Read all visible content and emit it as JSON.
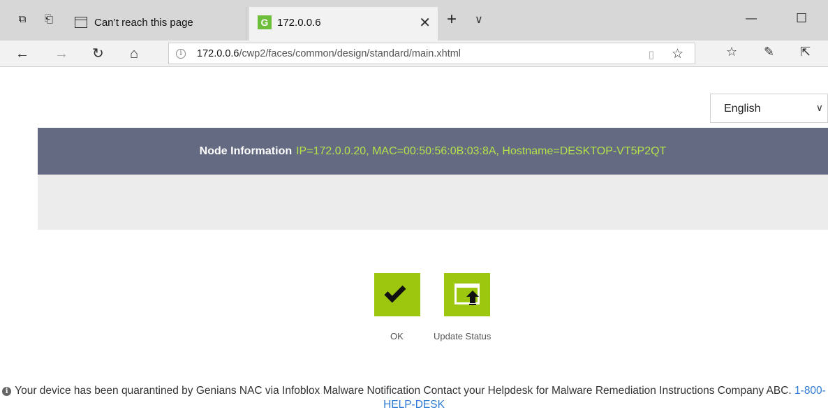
{
  "browser": {
    "tabs": [
      {
        "label": "Can’t reach this page",
        "icon": "page-icon",
        "active": false
      },
      {
        "label": "172.0.0.6",
        "icon": "genians-logo-icon",
        "favicon_letter": "G",
        "active": true
      }
    ],
    "address": {
      "host": "172.0.0.6",
      "path": "/cwp2/faces/common/design/standard/main.xhtml"
    }
  },
  "page": {
    "language": {
      "selected": "English"
    },
    "node": {
      "label": "Node Information",
      "values": "IP=172.0.0.20,   MAC=00:50:56:0B:03:8A,   Hostname=DESKTOP-VT5P2QT"
    },
    "actions": {
      "ok_label": "OK",
      "update_label": "Update Status"
    },
    "notice": {
      "text": "Your device has been quarantined by Genians NAC via Infoblox Malware Notification Contact your Helpdesk for Malware Remediation Instructions Company ABC.",
      "phone": "1-800-HELP-DESK"
    },
    "colors": {
      "header_bar": "#646a82",
      "node_values": "#b4e24a",
      "action_button": "#9dc70e",
      "link": "#2b7ad3"
    }
  }
}
